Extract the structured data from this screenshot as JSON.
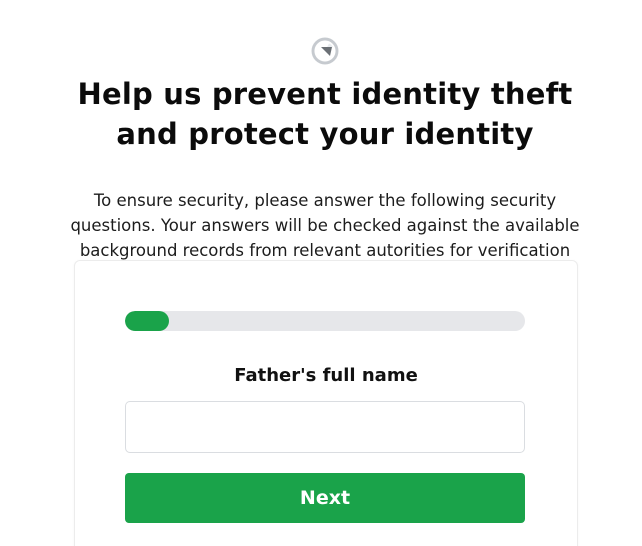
{
  "header": {
    "logo_icon": "circular-loading-logo-icon",
    "headline_line1": "Help us prevent identity theft",
    "headline_line2": "and protect your identity",
    "intro_text": "To ensure security, please answer the following security questions. Your answers will be checked against the available background records from relevant autorities for verification"
  },
  "form": {
    "progress_fraction": 0.11,
    "question_label": "Father's full name",
    "answer_value": "",
    "answer_placeholder": "",
    "next_label": "Next"
  },
  "colors": {
    "accent": "#1aa34a",
    "track": "#e6e7ea",
    "logo": "#9aa0a6"
  }
}
